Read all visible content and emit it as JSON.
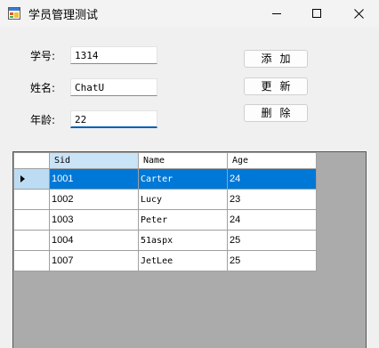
{
  "window": {
    "title": "学员管理测试"
  },
  "form": {
    "sid_label": "学号:",
    "sid_value": "1314",
    "name_label": "姓名:",
    "name_value": "ChatU",
    "age_label": "年龄:",
    "age_value": "22"
  },
  "buttons": {
    "add": "添加",
    "update": "更新",
    "delete": "删除"
  },
  "grid": {
    "columns": [
      "Sid",
      "Name",
      "Age"
    ],
    "rows": [
      [
        "1001",
        "Carter",
        "24"
      ],
      [
        "1002",
        "Lucy",
        "23"
      ],
      [
        "1003",
        "Peter",
        "24"
      ],
      [
        "1004",
        "51aspx",
        "25"
      ],
      [
        "1007",
        "JetLee",
        "25"
      ]
    ],
    "selected_row": 0
  },
  "icons": {
    "app": "app-window-icon",
    "minimize": "minimize-icon",
    "maximize": "maximize-icon",
    "close": "close-icon",
    "current_row": "row-pointer-icon"
  }
}
